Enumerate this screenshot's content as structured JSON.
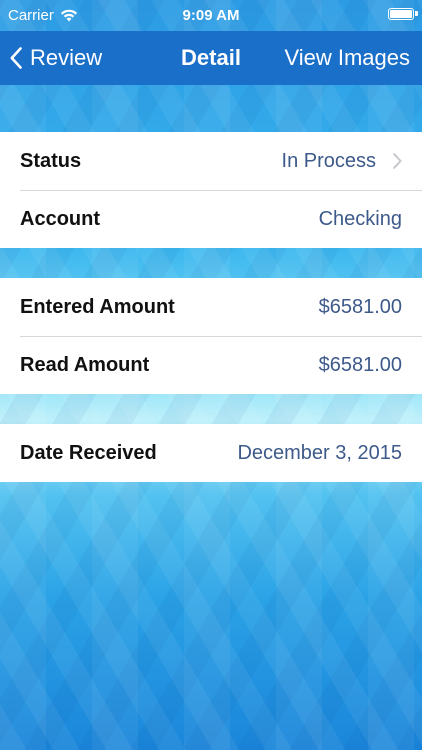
{
  "status_bar": {
    "carrier": "Carrier",
    "time": "9:09 AM"
  },
  "nav": {
    "back_label": "Review",
    "title": "Detail",
    "right_label": "View Images"
  },
  "groups": [
    {
      "rows": [
        {
          "label": "Status",
          "value": "In Process"
        },
        {
          "label": "Account",
          "value": "Checking"
        }
      ]
    },
    {
      "rows": [
        {
          "label": "Entered Amount",
          "value": "$6581.00"
        },
        {
          "label": "Read Amount",
          "value": "$6581.00"
        }
      ]
    },
    {
      "rows": [
        {
          "label": "Date Received",
          "value": "December 3, 2015"
        }
      ]
    }
  ],
  "colors": {
    "nav_background": "#1a6fc9",
    "value_text": "#3d5a8a",
    "label_text": "#111111"
  },
  "icons": [
    "wifi-icon",
    "battery-icon",
    "chevron-left-icon",
    "chevron-right-icon"
  ]
}
